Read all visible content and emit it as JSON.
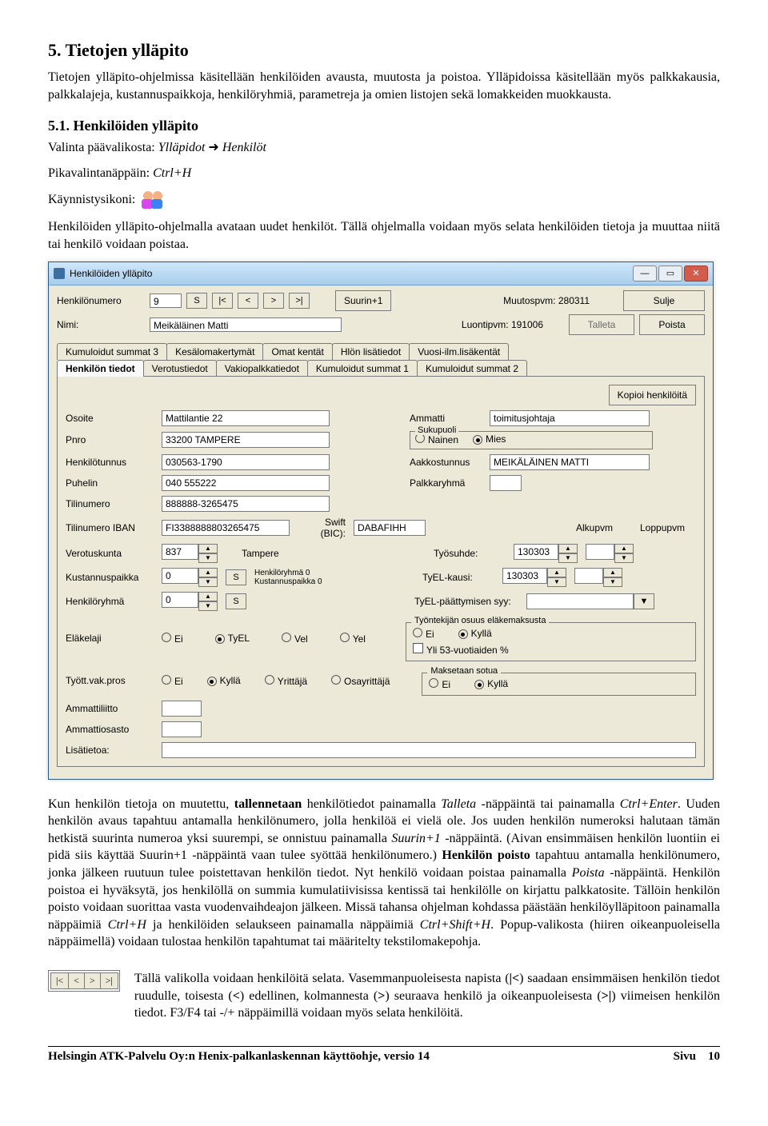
{
  "doc": {
    "h2": "5. Tietojen ylläpito",
    "p1": "Tietojen ylläpito-ohjelmissa käsitellään henkilöiden avausta, muutosta ja poistoa. Ylläpidoissa käsitellään myös palkkakausia, palkkalajeja, kustannuspaikkoja, henkilöryhmiä, parametreja ja omien listojen sekä lomakkeiden muokkausta.",
    "h3": "5.1. Henkilöiden ylläpito",
    "p2a": "Valinta päävalikosta: ",
    "p2b": "Ylläpidot ",
    "p2c": " Henkilöt",
    "p3a": "Pikavalintanäppäin: ",
    "p3b": "Ctrl+H",
    "p4": "Käynnistysikoni:",
    "p5": "Henkilöiden ylläpito-ohjelmalla avataan uudet henkilöt. Tällä ohjelmalla voidaan myös selata henkilöiden tietoja ja muuttaa niitä tai henkilö voidaan poistaa.",
    "after1a": "Kun henkilön tietoja on muutettu, ",
    "after1bold1": "tallennetaan",
    "after1b": " henkilötiedot painamalla ",
    "after1it1": "Talleta",
    "after1c": " -näppäintä tai painamalla ",
    "after1it2": "Ctrl+Enter",
    "after1d": ". Uuden henkilön avaus tapahtuu antamalla henkilönumero, jolla henkilöä ei vielä ole. Jos uuden henkilön numeroksi halutaan tämän hetkistä suurinta numeroa yksi suurempi, se onnistuu painamalla ",
    "after1it3": "Suurin+1",
    "after1e": " -näppäintä. (Aivan ensimmäisen henkilön luontiin ei pidä siis käyttää Suurin+1 -näppäintä vaan tulee syöttää henkilönumero.) ",
    "after1bold2": "Henkilön poisto",
    "after1f": " tapahtuu antamalla henkilönumero, jonka jälkeen ruutuun tulee poistettavan henkilön tiedot. Nyt henkilö voidaan poistaa painamalla ",
    "after1it4": "Poista",
    "after1g": " -näppäintä. Henkilön poistoa ei hyväksytä, jos henkilöllä on summia kumulatiivisissa kentissä tai henkilölle on kirjattu palkkatosite. Tällöin henkilön poisto voidaan suorittaa vasta vuodenvaihdeajon jälkeen. Missä tahansa ohjelman kohdassa päästään henkilöylläpitoon painamalla näppäimiä ",
    "after1it5": "Ctrl+H",
    "after1h": " ja henkilöiden selaukseen painamalla näppäimiä ",
    "after1it6": "Ctrl+Shift+H",
    "after1i": ". Popup-valikosta (hiiren oikeanpuoleisella näppäimellä) voidaan tulostaa henkilön tapahtumat tai määritelty tekstilomakepohja.",
    "after2a": "Tällä valikolla voidaan henkilöitä selata. Vasemmanpuoleisesta napista (",
    "nav1": "|<",
    "after2b": ") saadaan ensimmäisen henkilön tiedot ruudulle, toisesta (",
    "nav2": "<",
    "after2c": ") edellinen, kolmannesta (",
    "nav3": ">",
    "after2d": ") seuraava henkilö ja oikeanpuoleisesta (",
    "nav4": ">|",
    "after2e": ") viimeisen henkilön tiedot. F3/F4 tai -/+ näppäimillä voidaan myös selata henkilöitä.",
    "footer_left": "Helsingin ATK-Palvelu Oy:n Henix-palkanlaskennan käyttöohje, versio 14",
    "footer_right_lbl": "Sivu",
    "footer_right_num": "10"
  },
  "win": {
    "title": "Henkilöiden ylläpito",
    "lbl_henkilonumero": "Henkilönumero",
    "val_henkilonumero": "9",
    "btn_s": "S",
    "nav_first": "|<",
    "nav_prev": "<",
    "nav_next": ">",
    "nav_last": ">|",
    "btn_suurin": "Suurin+1",
    "lbl_muutospvm": "Muutospvm: 280311",
    "btn_sulje": "Sulje",
    "lbl_nimi": "Nimi:",
    "val_nimi": "Meikäläinen Matti",
    "lbl_luontipvm": "Luontipvm: 191006",
    "btn_talleta": "Talleta",
    "btn_poista": "Poista",
    "tabs_row1": [
      "Kumuloidut summat 3",
      "Kesälomakertymät",
      "Omat kentät",
      "Hlön lisätiedot",
      "Vuosi-ilm.lisäkentät"
    ],
    "tabs_row2": [
      "Henkilön tiedot",
      "Verotustiedot",
      "Vakiopalkkatiedot",
      "Kumuloidut summat 1",
      "Kumuloidut summat 2"
    ],
    "btn_kopioi": "Kopioi henkilöitä",
    "lbl_osoite": "Osoite",
    "val_osoite": "Mattilantie 22",
    "lbl_ammatti": "Ammatti",
    "val_ammatti": "toimitusjohtaja",
    "lbl_pnro": "Pnro",
    "val_pnro": "33200 TAMPERE",
    "lbl_sukupuoli": "Sukupuoli",
    "rb_nainen": "Nainen",
    "rb_mies": "Mies",
    "lbl_henkilotunnus": "Henkilötunnus",
    "val_henkilotunnus": "030563-1790",
    "lbl_aakkostunnus": "Aakkostunnus",
    "val_aakkostunnus": "MEIKÄLÄINEN MATTI",
    "lbl_puhelin": "Puhelin",
    "val_puhelin": "040 555222",
    "lbl_palkkaryhma": "Palkkaryhmä",
    "lbl_tilinumero": "Tilinumero",
    "val_tilinumero": "888888-3265475",
    "lbl_tilinumero_iban": "Tilinumero IBAN",
    "val_tilinumero_iban": "FI3388888803265475",
    "lbl_swift": "Swift (BIC):",
    "val_swift": "DABAFIHH",
    "lbl_alkupvm": "Alkupvm",
    "lbl_loppupvm": "Loppupvm",
    "lbl_verotuskunta": "Verotuskunta",
    "val_verotuskunta": "837",
    "val_verotuskunta_name": "Tampere",
    "lbl_tyosuhde": "Työsuhde:",
    "val_tyosuhde": "130303",
    "lbl_kustannuspaikka": "Kustannuspaikka",
    "val_kustannuspaikka": "0",
    "txt_henkkust": "Henkilöryhmä 0\nKustannuspaikka 0",
    "lbl_tyelkausi": "TyEL-kausi:",
    "val_tyelkausi": "130303",
    "lbl_henkiloryhma": "Henkilöryhmä",
    "val_henkiloryhma": "0",
    "lbl_tyelpaatt": "TyEL-päättymisen syy:",
    "lbl_elakelaji": "Eläkelaji",
    "rb_ei": "Ei",
    "rb_tyel": "TyEL",
    "rb_vel": "Vel",
    "rb_yel": "Yel",
    "lbl_tyontosuus_legend": "Työntekijän osuus eläkemaksusta",
    "rb_kylla": "Kyllä",
    "cb_yli53": "Yli 53-vuotiaiden %",
    "lbl_tyottvak": "Tyött.vak.pros",
    "rb_yrittaja": "Yrittäjä",
    "rb_osayrittaja": "Osayrittäjä",
    "lbl_maksetaan_legend": "Maksetaan sotua",
    "lbl_ammattiliitto": "Ammattiliitto",
    "lbl_ammattiosasto": "Ammattiosasto",
    "lbl_lisatietoa": "Lisätietoa:"
  }
}
